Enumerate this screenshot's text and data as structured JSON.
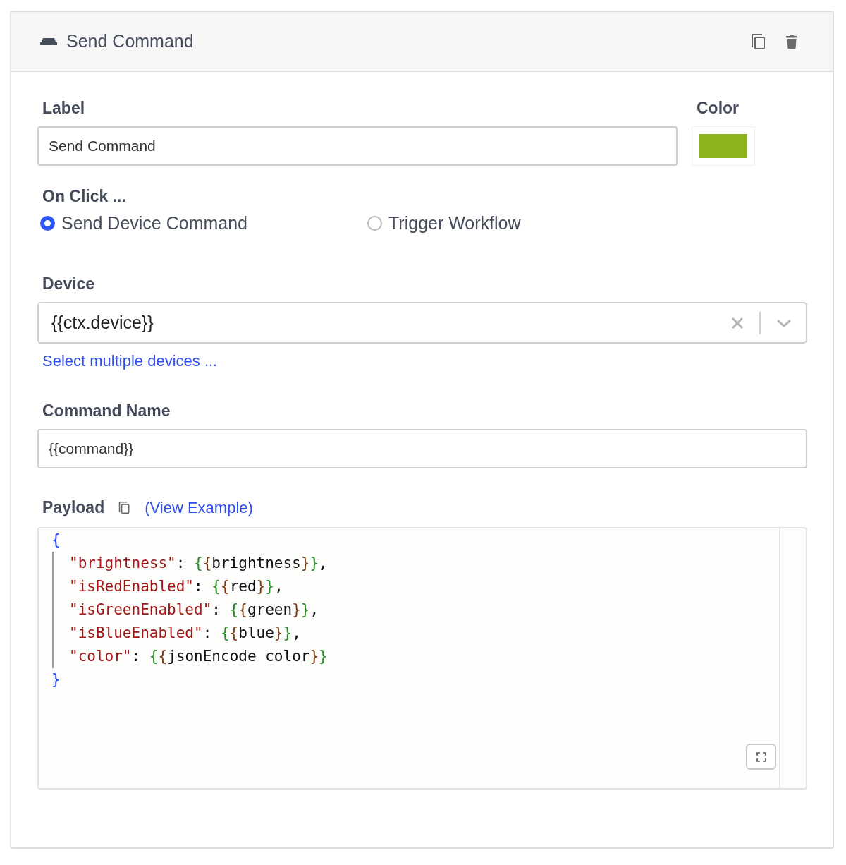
{
  "panel": {
    "title": "Send Command"
  },
  "label_field": {
    "label": "Label",
    "value": "Send Command"
  },
  "color_field": {
    "label": "Color",
    "color": "#8db31c"
  },
  "on_click": {
    "label": "On Click ...",
    "options": [
      {
        "label": "Send Device Command",
        "selected": true
      },
      {
        "label": "Trigger Workflow",
        "selected": false
      }
    ]
  },
  "device": {
    "label": "Device",
    "value": "{{ctx.device}}",
    "link": "Select multiple devices ..."
  },
  "command_name": {
    "label": "Command Name",
    "value": "{{command}}"
  },
  "payload": {
    "label": "Payload",
    "link": "(View Example)",
    "code_lines": [
      [
        {
          "kind": "outer",
          "text": "{"
        }
      ],
      [
        {
          "kind": "key",
          "text": "\"brightness\""
        },
        {
          "kind": "plain",
          "text": ": "
        },
        {
          "kind": "open",
          "text": "{{"
        },
        {
          "kind": "plain",
          "text": "brightness"
        },
        {
          "kind": "close",
          "text": "}}"
        },
        {
          "kind": "plain",
          "text": ","
        }
      ],
      [
        {
          "kind": "key",
          "text": "\"isRedEnabled\""
        },
        {
          "kind": "plain",
          "text": ": "
        },
        {
          "kind": "open",
          "text": "{{"
        },
        {
          "kind": "plain",
          "text": "red"
        },
        {
          "kind": "close",
          "text": "}}"
        },
        {
          "kind": "plain",
          "text": ","
        }
      ],
      [
        {
          "kind": "key",
          "text": "\"isGreenEnabled\""
        },
        {
          "kind": "plain",
          "text": ": "
        },
        {
          "kind": "open",
          "text": "{{"
        },
        {
          "kind": "plain",
          "text": "green"
        },
        {
          "kind": "close",
          "text": "}}"
        },
        {
          "kind": "plain",
          "text": ","
        }
      ],
      [
        {
          "kind": "key",
          "text": "\"isBlueEnabled\""
        },
        {
          "kind": "plain",
          "text": ": "
        },
        {
          "kind": "open",
          "text": "{{"
        },
        {
          "kind": "plain",
          "text": "blue"
        },
        {
          "kind": "close",
          "text": "}}"
        },
        {
          "kind": "plain",
          "text": ","
        }
      ],
      [
        {
          "kind": "key",
          "text": "\"color\""
        },
        {
          "kind": "plain",
          "text": ": "
        },
        {
          "kind": "open",
          "text": "{{"
        },
        {
          "kind": "plain",
          "text": "jsonEncode color"
        },
        {
          "kind": "close",
          "text": "}}"
        }
      ],
      [
        {
          "kind": "outer",
          "text": "}"
        }
      ]
    ]
  }
}
